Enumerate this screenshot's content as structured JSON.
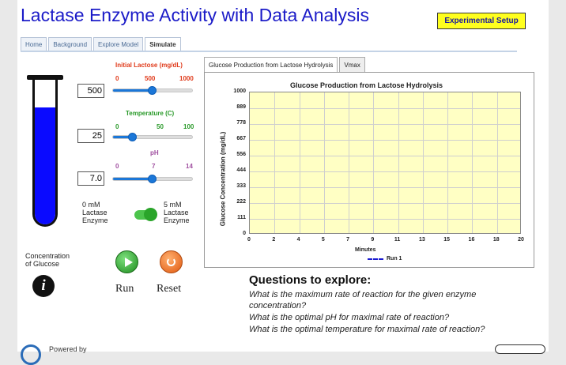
{
  "app": {
    "title": "Lactase Enzyme Activity with Data Analysis",
    "setup_button": "Experimental Setup"
  },
  "nav_tabs": [
    {
      "label": "Home"
    },
    {
      "label": "Background"
    },
    {
      "label": "Explore Model"
    },
    {
      "label": "Simulate",
      "active": true
    }
  ],
  "controls": {
    "lactose": {
      "label": "Initial Lactose (mg/dL)",
      "min": "0",
      "mid": "500",
      "max": "1000",
      "value": "500",
      "fraction": 0.5
    },
    "temperature": {
      "label": "Temperature (C)",
      "min": "0",
      "mid": "50",
      "max": "100",
      "value": "25",
      "fraction": 0.25
    },
    "ph": {
      "label": "pH",
      "min": "0",
      "mid": "7",
      "max": "14",
      "value": "7.0",
      "fraction": 0.5
    },
    "enzyme": {
      "left_label_1": "0 mM",
      "left_label_2": "Lactase",
      "left_label_3": "Enzyme",
      "right_label_1": "5 mM",
      "right_label_2": "Lactase",
      "right_label_3": "Enzyme",
      "on": true
    },
    "tube_fill_fraction": 0.8
  },
  "concentration": {
    "label_1": "Concentration",
    "label_2": "of Glucose"
  },
  "buttons": {
    "run": "Run",
    "reset": "Reset"
  },
  "chart_tabs": [
    {
      "label": "Glucose Production from Lactose Hydrolysis",
      "active": true
    },
    {
      "label": "Vmax"
    }
  ],
  "chart_data": {
    "type": "line",
    "title": "Glucose Production from Lactose Hydrolysis",
    "xlabel": "Minutes",
    "ylabel": "Glucose Concentration (mg/dL)",
    "xlim": [
      0,
      20
    ],
    "ylim": [
      0,
      1000
    ],
    "x_ticks": [
      "0",
      "2",
      "4",
      "5",
      "7",
      "9",
      "11",
      "13",
      "15",
      "16",
      "18",
      "20"
    ],
    "y_ticks": [
      "1000",
      "889",
      "778",
      "667",
      "556",
      "444",
      "333",
      "222",
      "111",
      "0"
    ],
    "grid": true,
    "legend_position": "bottom",
    "series": [
      {
        "name": "Run 1",
        "color": "#1a1ad0",
        "values": []
      }
    ]
  },
  "questions": {
    "title": "Questions to explore:",
    "lines": [
      "What is the maximum rate of reaction for the given enzyme",
      "concentration?",
      "What is the optimal pH for maximal rate of reaction?",
      "What is the optimal temperature for maximal rate of reaction?"
    ]
  },
  "footer": {
    "powered_by": "Powered by"
  },
  "colors": {
    "title": "#1b1bc8",
    "setup_button": "#ffff1e",
    "slider": "#1b77d8",
    "tube_liquid": "#0a0aff",
    "plot_bg": "#ffffc4"
  }
}
